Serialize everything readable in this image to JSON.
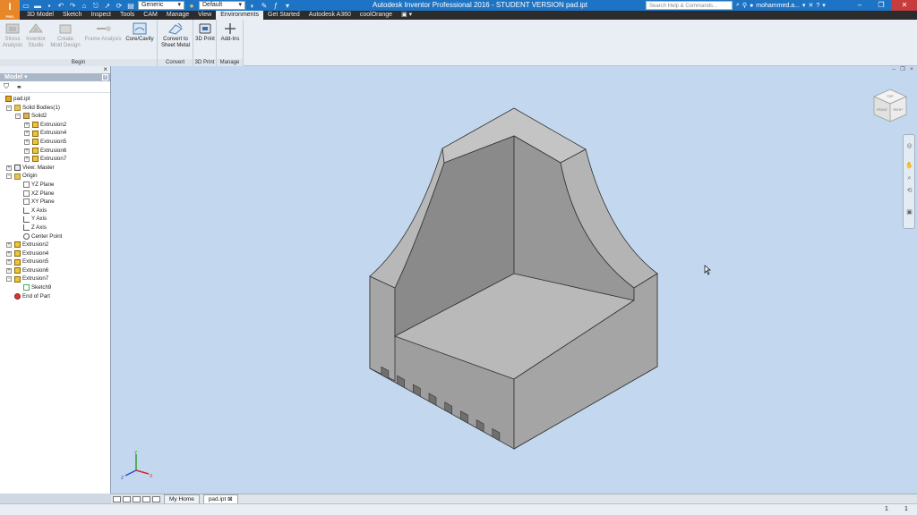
{
  "app": {
    "logo_letter": "I",
    "logo_sub": "PRO",
    "title": "Autodesk Inventor Professional 2016 - STUDENT VERSION     pad.ipt",
    "search_placeholder": "Search Help & Commands...",
    "user": "mohammed.a...",
    "material_select": "Generic",
    "appearance_select": "Default"
  },
  "tabs": [
    "3D Model",
    "Sketch",
    "Inspect",
    "Tools",
    "CAM",
    "Manage",
    "View",
    "Environments",
    "Get Started",
    "Autodesk A360",
    "coolOrange"
  ],
  "active_tab": "Environments",
  "ribbon": {
    "groups": [
      {
        "label": "Begin",
        "buttons": [
          {
            "label": "Stress\nAnalysis",
            "icon": "stress-analysis-icon",
            "enabled": false
          },
          {
            "label": "Inventor\nStudio",
            "icon": "inventor-studio-icon",
            "enabled": false
          },
          {
            "label": "Create\nMold Design",
            "icon": "mold-design-icon",
            "enabled": false
          },
          {
            "label": "Frame Analysis",
            "icon": "frame-analysis-icon",
            "enabled": false
          },
          {
            "label": "Core/Cavity",
            "icon": "core-cavity-icon",
            "enabled": true
          }
        ]
      },
      {
        "label": "Convert",
        "buttons": [
          {
            "label": "Convert to\nSheet Metal",
            "icon": "sheet-metal-icon",
            "enabled": true
          }
        ]
      },
      {
        "label": "3D Print",
        "buttons": [
          {
            "label": "3D Print",
            "icon": "3d-print-icon",
            "enabled": true
          }
        ]
      },
      {
        "label": "Manage",
        "buttons": [
          {
            "label": "Add-Ins",
            "icon": "add-ins-icon",
            "enabled": true
          }
        ]
      }
    ]
  },
  "browser": {
    "title": "Model ▾",
    "help": "?",
    "tree": [
      {
        "label": "pad.ipt",
        "level": 0,
        "icon": "part",
        "expander": ""
      },
      {
        "label": "Solid Bodies(1)",
        "level": 1,
        "icon": "folder",
        "expander": "−"
      },
      {
        "label": "Solid2",
        "level": 2,
        "icon": "solid",
        "expander": "−"
      },
      {
        "label": "Extrusion2",
        "level": 3,
        "icon": "feature",
        "expander": "+"
      },
      {
        "label": "Extrusion4",
        "level": 3,
        "icon": "feature",
        "expander": "+"
      },
      {
        "label": "Extrusion5",
        "level": 3,
        "icon": "feature",
        "expander": "+"
      },
      {
        "label": "Extrusion6",
        "level": 3,
        "icon": "feature",
        "expander": "+"
      },
      {
        "label": "Extrusion7",
        "level": 3,
        "icon": "feature",
        "expander": "+"
      },
      {
        "label": "View: Master",
        "level": 1,
        "icon": "view",
        "expander": "+"
      },
      {
        "label": "Origin",
        "level": 1,
        "icon": "folder",
        "expander": "−"
      },
      {
        "label": "YZ Plane",
        "level": 2,
        "icon": "plane",
        "expander": ""
      },
      {
        "label": "XZ Plane",
        "level": 2,
        "icon": "plane",
        "expander": ""
      },
      {
        "label": "XY Plane",
        "level": 2,
        "icon": "plane",
        "expander": ""
      },
      {
        "label": "X Axis",
        "level": 2,
        "icon": "axis",
        "expander": ""
      },
      {
        "label": "Y Axis",
        "level": 2,
        "icon": "axis",
        "expander": ""
      },
      {
        "label": "Z Axis",
        "level": 2,
        "icon": "axis",
        "expander": ""
      },
      {
        "label": "Center Point",
        "level": 2,
        "icon": "point",
        "expander": ""
      },
      {
        "label": "Extrusion2",
        "level": 1,
        "icon": "feature",
        "expander": "+"
      },
      {
        "label": "Extrusion4",
        "level": 1,
        "icon": "feature",
        "expander": "+"
      },
      {
        "label": "Extrusion5",
        "level": 1,
        "icon": "feature",
        "expander": "+"
      },
      {
        "label": "Extrusion6",
        "level": 1,
        "icon": "feature",
        "expander": "+"
      },
      {
        "label": "Extrusion7",
        "level": 1,
        "icon": "feature",
        "expander": "−"
      },
      {
        "label": "Sketch9",
        "level": 2,
        "icon": "sketch",
        "expander": ""
      },
      {
        "label": "End of Part",
        "level": 1,
        "icon": "end",
        "expander": ""
      }
    ]
  },
  "viewcube": {
    "top": "TOP",
    "front": "FRONT",
    "right": "RIGHT"
  },
  "triad": {
    "x": "X",
    "y": "Y",
    "z": "Z"
  },
  "document_tabs": [
    "My Home",
    "pad.ipt"
  ],
  "active_document": "pad.ipt",
  "status": {
    "left_count": "1",
    "right_count": "1"
  },
  "colors": {
    "title_bar": "#1e74c4",
    "viewport_bg": "#c3d8ee",
    "part_face_light": "#bdbdbd",
    "part_face_mid": "#a9a9a9",
    "part_face_dark": "#8a8a8a",
    "logo": "#e8872a"
  }
}
